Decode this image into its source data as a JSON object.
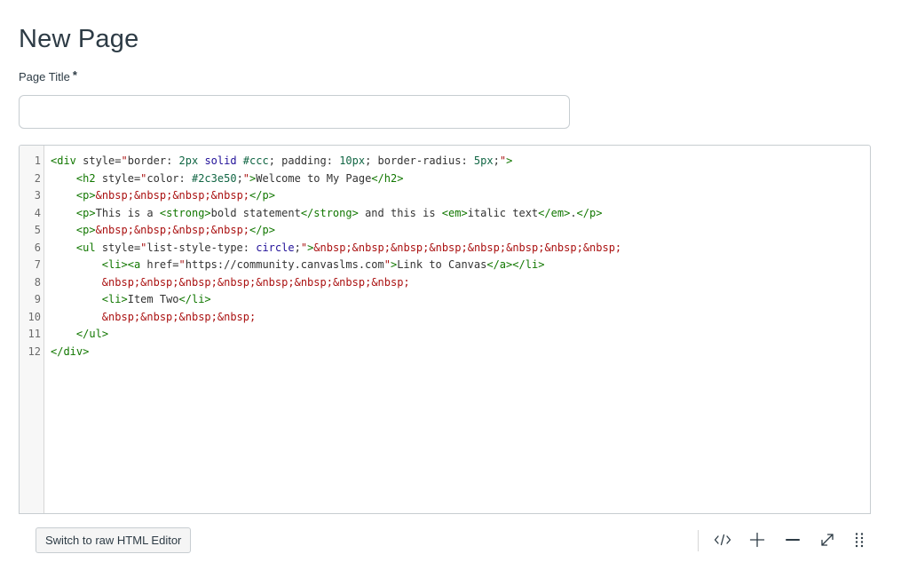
{
  "header": {
    "title": "New Page"
  },
  "form": {
    "title_label": "Page Title",
    "required_mark": "*",
    "title_value": ""
  },
  "editor": {
    "line_numbers": [
      "1",
      "2",
      "3",
      "4",
      "5",
      "6",
      "7",
      "8",
      "9",
      "10",
      "11",
      "12"
    ],
    "lines": [
      "<div style=\"border: 2px solid #ccc; padding: 10px; border-radius: 5px;\">",
      "    <h2 style=\"color: #2c3e50;\">Welcome to My Page</h2>",
      "    <p>&nbsp;&nbsp;&nbsp;&nbsp;</p>",
      "    <p>This is a <strong>bold statement</strong> and this is <em>italic text</em>.</p>",
      "    <p>&nbsp;&nbsp;&nbsp;&nbsp;</p>",
      "    <ul style=\"list-style-type: circle;\">&nbsp;&nbsp;&nbsp;&nbsp;&nbsp;&nbsp;&nbsp;&nbsp;",
      "        <li><a href=\"https://community.canvaslms.com\">Link to Canvas</a></li>",
      "        &nbsp;&nbsp;&nbsp;&nbsp;&nbsp;&nbsp;&nbsp;&nbsp;",
      "        <li>Item Two</li>",
      "        &nbsp;&nbsp;&nbsp;&nbsp;",
      "    </ul>",
      "</div>"
    ]
  },
  "footer": {
    "switch_label": "Switch to raw HTML Editor",
    "icons": [
      "code-view-icon",
      "plus-icon",
      "minus-icon",
      "fullscreen-icon",
      "drag-handle-icon"
    ]
  },
  "colors": {
    "tag": "#117700",
    "string": "#aa1111",
    "number": "#116644",
    "keyword": "#221199"
  }
}
